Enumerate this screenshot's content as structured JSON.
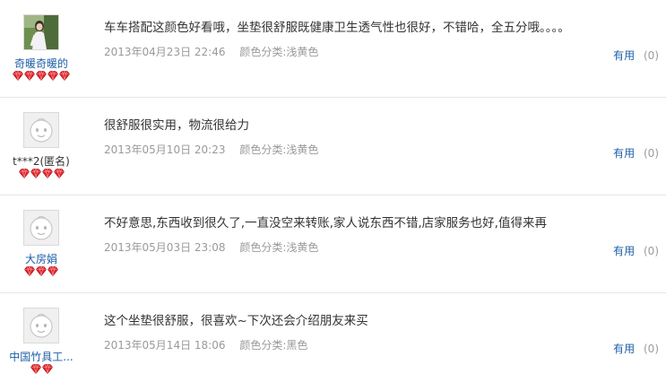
{
  "reviews": [
    {
      "username": "奇暖奇暖的",
      "username_style": "link",
      "avatar": "photo-avatar",
      "rank_icons": [
        "heart-gem-icon",
        "heart-gem-icon",
        "heart-gem-icon",
        "heart-gem-icon",
        "heart-gem-icon"
      ],
      "comment": "车车搭配这颜色好看哦，坐垫很舒服既健康卫生透气性也很好，不错哈，全五分哦。。。。",
      "date": "2013年04月23日 22:46",
      "color_category": "颜色分类:浅黄色",
      "useful_label": "有用",
      "useful_count": "(0)"
    },
    {
      "username": "t***2(匿名)",
      "username_style": "plain",
      "avatar": "default-face-avatar",
      "rank_icons": [
        "heart-gem-icon",
        "heart-gem-icon",
        "heart-gem-icon",
        "heart-gem-icon"
      ],
      "comment": "很舒服很实用，物流很给力",
      "date": "2013年05月10日 20:23",
      "color_category": "颜色分类:浅黄色",
      "useful_label": "有用",
      "useful_count": "(0)"
    },
    {
      "username": "大房娟",
      "username_style": "link",
      "avatar": "default-face-avatar",
      "rank_icons": [
        "heart-gem-icon",
        "heart-gem-icon",
        "heart-gem-icon"
      ],
      "comment": "不好意思,东西收到很久了,一直没空来转账,家人说东西不错,店家服务也好,值得来再",
      "date": "2013年05月03日 23:08",
      "color_category": "颜色分类:浅黄色",
      "useful_label": "有用",
      "useful_count": "(0)"
    },
    {
      "username": "中国竹具工...",
      "username_style": "link",
      "avatar": "default-face-avatar",
      "rank_icons": [
        "heart-gem-icon",
        "heart-gem-icon"
      ],
      "comment": "这个坐垫很舒服，很喜欢~下次还会介绍朋友来买",
      "date": "2013年05月14日 18:06",
      "color_category": "颜色分类:黑色",
      "useful_label": "有用",
      "useful_count": "(0)"
    }
  ],
  "colors": {
    "link": "#1c5ea8",
    "meta": "#9a9a9a",
    "text": "#333333",
    "gem": "#e0262c",
    "divider": "#e6e6e6"
  }
}
